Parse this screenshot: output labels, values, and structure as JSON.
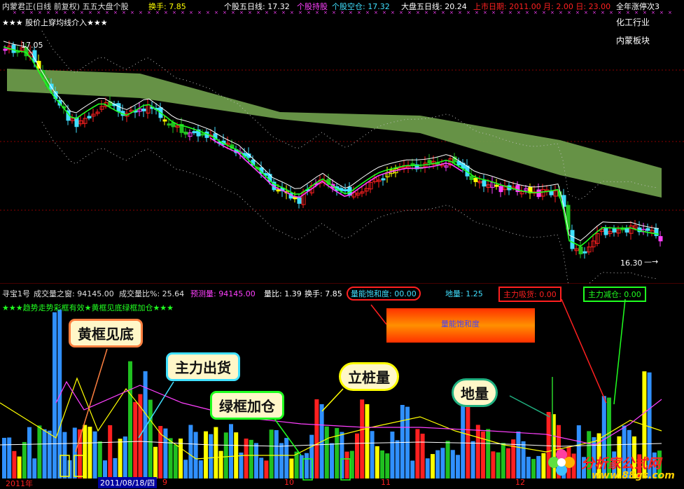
{
  "colors": {
    "up": "#ff2020",
    "down": "#40e0ff",
    "green_band": "#6b9a4a",
    "ma_white": "#ffffff",
    "ma_green": "#20ff20",
    "ma_magenta": "#ff40ff",
    "yellow": "#ffff00",
    "grid": "#8b0000"
  },
  "price_header": {
    "stock_label": "内蒙君正(日线 前复权) 五五大盘个股",
    "turnover": "换手: 7.85",
    "ma5_stock": "个股五日线: 17.32",
    "hold": "个股持股",
    "empty": "个股空仓: 17.32",
    "ma5_index": "大盘五日线: 20.24",
    "listing_date": "上市日期: 2011.00 月: 2.00 日: 23.00",
    "limit_up_count": "全年涨停次3",
    "signal": "★★★ 股价上穿均线介入★★★",
    "industry": "化工行业",
    "region": "内蒙板块",
    "high_marker": "17.05",
    "time_marker": "16.30"
  },
  "volume_header": {
    "indicator": "寻宝1号",
    "volume_window": "成交量之窗: 94145.00",
    "volume_ratio": "成交量比%: 25.64",
    "predicted": "预测量: 94145.00",
    "liang_bi": "量比: 1.39",
    "turnover": "换手: 7.85",
    "saturation": "量能饱和度: 00.00",
    "di_liang": "地量: 1.25",
    "main_absorb": "主力吸货: 0.00",
    "main_reduce": "主力减仓: 0.00",
    "signal": "★★★趋势走势彩框有效★黄框见底绿框加仓★★★",
    "saturation_bar_label": "量能饱和度"
  },
  "callouts": {
    "yellow_bottom": "黄框见底",
    "main_selling": "主力出货",
    "green_add": "绿框加仓",
    "pile_volume": "立桩量",
    "ground_volume": "地量"
  },
  "x_axis": {
    "year": "2011年",
    "cursor_date": "2011/08/18/四",
    "m9": "9",
    "m10": "10",
    "m11": "11",
    "m12": "12"
  },
  "watermark": {
    "brand": "分析家公式网",
    "url": "www.88gs.com"
  }
}
